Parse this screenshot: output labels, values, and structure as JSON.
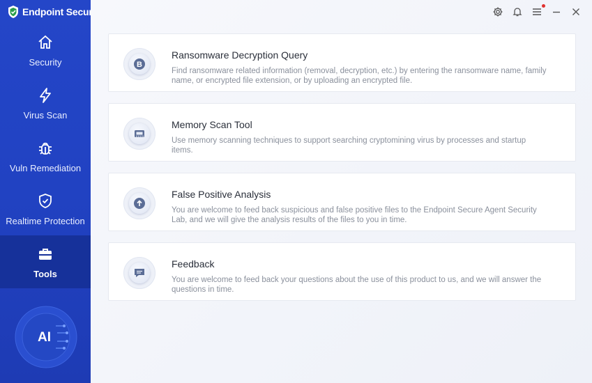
{
  "app": {
    "title": "Endpoint Secure"
  },
  "sidebar": {
    "items": [
      {
        "label": "Security",
        "icon": "home-icon",
        "active": false
      },
      {
        "label": "Virus Scan",
        "icon": "lightning-icon",
        "active": false
      },
      {
        "label": "Vuln Remediation",
        "icon": "bug-icon",
        "active": false
      },
      {
        "label": "Realtime Protection",
        "icon": "shield-check-icon",
        "active": false
      },
      {
        "label": "Tools",
        "icon": "toolbox-icon",
        "active": true
      }
    ],
    "ai_badge": "AI"
  },
  "topbar": {
    "icons": [
      "settings-icon",
      "bell-icon",
      "menu-icon",
      "minimize-icon",
      "close-icon"
    ],
    "notification_color": "#e0322f"
  },
  "tools": [
    {
      "title": "Ransomware Decryption Query",
      "description": "Find ransomware related information (removal, decryption, etc.) by entering the ransomware name, family name, or encrypted file extension, or by uploading an encrypted file.",
      "icon": "bitcoin-icon"
    },
    {
      "title": "Memory Scan Tool",
      "description": "Use memory scanning techniques to support searching cryptomining virus by processes and startup items.",
      "icon": "memory-chip-icon"
    },
    {
      "title": "False Positive Analysis",
      "description": "You are welcome to feed back suspicious and false positive files to the Endpoint Secure Agent Security Lab, and we will give the analysis results of the files to you in time.",
      "icon": "upload-icon"
    },
    {
      "title": "Feedback",
      "description": "You are welcome to feed back your questions about the use of this product to us, and we will answer the questions in time.",
      "icon": "chat-icon"
    }
  ],
  "colors": {
    "sidebar": "#2446c8",
    "active_item": "#16319a",
    "accent": "#3d5fd6"
  }
}
